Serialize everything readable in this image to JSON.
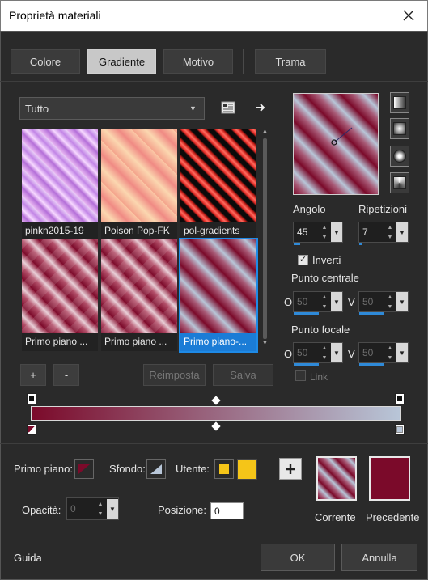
{
  "window": {
    "title": "Proprietà materiali"
  },
  "tabs": [
    {
      "label": "Colore",
      "active": false
    },
    {
      "label": "Gradiente",
      "active": true
    },
    {
      "label": "Motivo",
      "active": false
    },
    {
      "label": "Trama",
      "active": false
    }
  ],
  "category": {
    "selected": "Tutto"
  },
  "gradients": [
    {
      "caption": "pinkn2015-19",
      "selected": false
    },
    {
      "caption": "Poison Pop-FK",
      "selected": false
    },
    {
      "caption": "pol-gradients",
      "selected": false
    },
    {
      "caption": "Primo piano ...",
      "selected": false
    },
    {
      "caption": "Primo piano ...",
      "selected": false
    },
    {
      "caption": "Primo piano-...",
      "selected": true
    }
  ],
  "list_buttons": {
    "add": "+",
    "remove": "-",
    "reset": "Reimposta",
    "save": "Salva"
  },
  "angle": {
    "label": "Angolo",
    "value": "45",
    "fill": 0.125
  },
  "repeats": {
    "label": "Ripetizioni",
    "value": "7",
    "fill": 0.07
  },
  "invert": {
    "label": "Inverti",
    "checked": true
  },
  "center_point": {
    "label": "Punto centrale",
    "o_label": "O",
    "v_label": "V",
    "o_value": "50",
    "v_value": "50"
  },
  "focal_point": {
    "label": "Punto focale",
    "o_label": "O",
    "v_label": "V",
    "o_value": "50",
    "v_value": "50"
  },
  "link": {
    "label": "Link",
    "checked": false
  },
  "materials": {
    "foreground_label": "Primo piano:",
    "background_label": "Sfondo:",
    "user_label": "Utente:",
    "opacity_label": "Opacità:",
    "opacity_value": "0",
    "position_label": "Posizione:",
    "position_value": "0"
  },
  "previews": {
    "current_label": "Corrente",
    "previous_label": "Precedente"
  },
  "colors": {
    "gradient_start": "#7b0a2a",
    "gradient_end": "#b8c6d8",
    "previous": "#7b0a2a",
    "user": "#f5c518",
    "accent": "#1b7cd6"
  },
  "footer": {
    "help": "Guida",
    "ok": "OK",
    "cancel": "Annulla"
  }
}
